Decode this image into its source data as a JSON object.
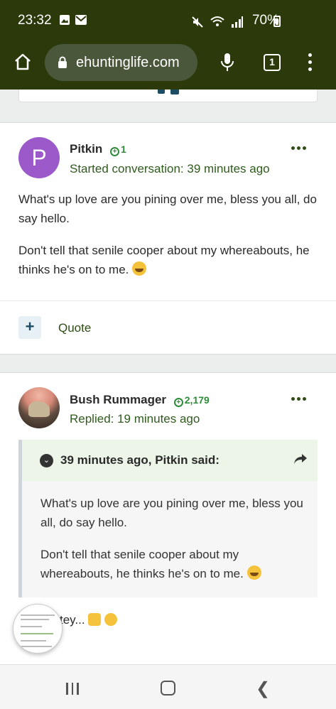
{
  "status": {
    "time": "23:32",
    "battery": "70%"
  },
  "browser": {
    "url": "ehuntinglife.com",
    "tab_count": "1"
  },
  "post1": {
    "avatar_letter": "P",
    "username": "Pitkin",
    "reputation": "1",
    "meta": "Started conversation: 39 minutes ago",
    "paragraph1": "What's up love are you pining over me, bless you all, do say hello.",
    "paragraph2": "Don't tell that senile cooper about my whereabouts, he thinks he's on to me.",
    "quote_label": "Quote"
  },
  "post2": {
    "username": "Bush Rummager",
    "reputation": "2,179",
    "meta": "Replied: 19 minutes ago",
    "quote_title": "39 minutes ago, Pitkin said:",
    "quote_paragraph1": "What's up love are you pining over me, bless you all, do say hello.",
    "quote_paragraph2": "Don't tell that senile cooper about my whereabouts, he thinks he's on to me.",
    "reply_text": "tey..."
  },
  "colors": {
    "brand_bar": "#2c3a0b",
    "accent_green": "#2f8a3b",
    "link_green": "#2f4d16"
  }
}
